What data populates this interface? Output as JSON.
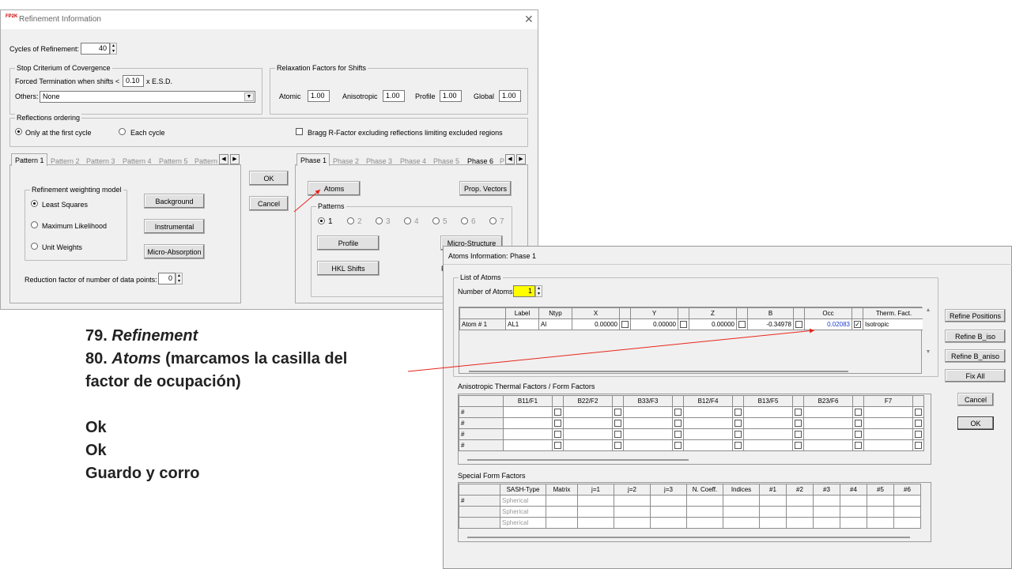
{
  "refinement_window": {
    "title": "Refinement Information",
    "app_icon_text": "FP2K",
    "cycles_label": "Cycles of Refinement:",
    "cycles_value": "40",
    "stop_group": "Stop Criterium of Covergence",
    "forced_label": "Forced Termination when  shifts <",
    "forced_value": "0.10",
    "esd_label": "x  E.S.D.",
    "others_label": "Others:",
    "others_value": "None",
    "relax_group": "Relaxation Factors for Shifts",
    "relax": [
      {
        "label": "Atomic",
        "value": "1.00"
      },
      {
        "label": "Anisotropic",
        "value": "1.00"
      },
      {
        "label": "Profile",
        "value": "1.00"
      },
      {
        "label": "Global",
        "value": "1.00"
      }
    ],
    "reflections_group": "Reflections ordering",
    "refl_opt1": "Only at the first cycle",
    "refl_opt2": "Each cycle",
    "bragg_label": "Bragg R-Factor excluding  reflections limiting excluded regions",
    "pattern_tabs": [
      "Pattern 1",
      "Pattern 2",
      "Pattern 3",
      "Pattern 4",
      "Pattern 5",
      "Pattern"
    ],
    "weight_group": "Refinement weighting model",
    "weight_opts": [
      "Least Squares",
      "Maximum Likelihood",
      "Unit Weights"
    ],
    "btn_background": "Background",
    "btn_instrumental": "Instrumental",
    "btn_microabs": "Micro-Absorption",
    "reduction_label": "Reduction factor of number of data points:",
    "reduction_value": "0",
    "ok": "OK",
    "cancel": "Cancel",
    "phase_tabs": [
      "Phase 1",
      "Phase 2",
      "Phase 3",
      "Phase 4",
      "Phase 5",
      "Phase 6",
      "P"
    ],
    "btn_atoms": "Atoms",
    "btn_propvectors": "Prop. Vectors",
    "patterns_group": "Patterns",
    "pattern_radios": [
      "1",
      "2",
      "3",
      "4",
      "5",
      "6",
      "7"
    ],
    "btn_profile": "Profile",
    "btn_microstructure": "Micro-Structure",
    "btn_hklshifts": "HKL Shifts",
    "btn_partial": "F"
  },
  "atoms_window": {
    "title": "Atoms Information: Phase  1",
    "list_group": "List of Atoms",
    "num_atoms_label": "Number of Atoms:",
    "num_atoms_value": "1",
    "headers": [
      "Label",
      "Ntyp",
      "X",
      "Y",
      "Z",
      "B",
      "Occ",
      "Therm. Fact."
    ],
    "row": {
      "rowlabel": "Atom #  1",
      "label": "AL1",
      "ntyp": "Al",
      "x": "0.00000",
      "y": "0.00000",
      "z": "0.00000",
      "b": "-0.34978",
      "occ": "0.02083",
      "therm": "Isotropic"
    },
    "aniso_group": "Anisotropic Thermal Factors / Form Factors",
    "aniso_headers": [
      "B11/F1",
      "B22/F2",
      "B33/F3",
      "B12/F4",
      "B13/F5",
      "B23/F6",
      "F7"
    ],
    "hash": "#",
    "special_group": "Special Form Factors",
    "special_headers": [
      "SASH-Type",
      "Matrix",
      "j=1",
      "j=2",
      "j=3",
      "N. Coeff.",
      "Indices",
      "#1",
      "#2",
      "#3",
      "#4",
      "#5",
      "#6"
    ],
    "spherical": "Spherical",
    "btn_refine_positions": "Refine Positions",
    "btn_refine_biso": "Refine B_iso",
    "btn_refine_baniso": "Refine B_aniso",
    "btn_fixall": "Fix All",
    "btn_cancel": "Cancel",
    "btn_ok": "OK"
  },
  "notes": {
    "line1_num": "79.",
    "line1_text": "Refinement",
    "line2_num": "80.",
    "line2_em": "Atoms",
    "line2_rest": "(marcamos la casilla del",
    "line3": "factor de ocupación)",
    "line4": "Ok",
    "line5": "Ok",
    "line6": "Guardo y corro"
  },
  "colors": {
    "arrow": "#e8241c",
    "highlight_yellow": "#ffff00",
    "occ_blue": "#1a3ccc"
  }
}
